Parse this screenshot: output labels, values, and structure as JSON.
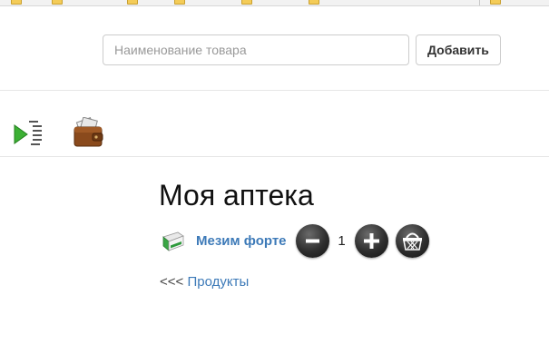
{
  "bookmarks": [],
  "search": {
    "placeholder": "Наименование товара",
    "value": ""
  },
  "toolbar": {
    "add_label": "Добавить"
  },
  "nav_icons": {
    "list": "play-list-icon",
    "wallet": "wallet-icon"
  },
  "page": {
    "title": "Моя аптека"
  },
  "cart": {
    "product_name": "Мезим форте",
    "quantity": "1"
  },
  "back": {
    "arrows": "<<<",
    "link_label": "Продукты"
  },
  "colors": {
    "link": "#3d7ab8",
    "button_dark": "#2e2e2e",
    "border": "#cccccc"
  }
}
